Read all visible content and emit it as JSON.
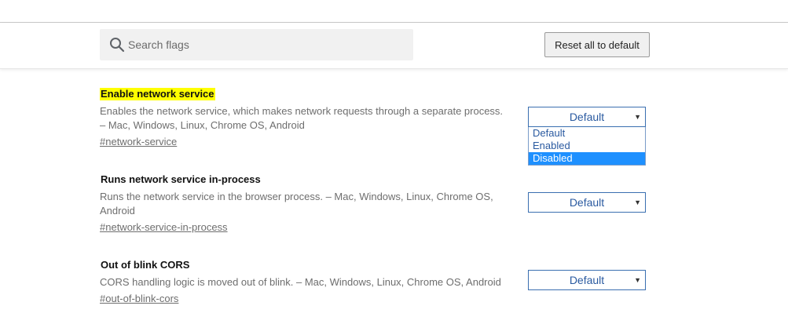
{
  "search": {
    "placeholder": "Search flags",
    "value": ""
  },
  "header": {
    "reset_label": "Reset all to default"
  },
  "flags": [
    {
      "title": "Enable network service",
      "description": "Enables the network service, which makes network requests through a separate process. – Mac, Windows, Linux, Chrome OS, Android",
      "link": "#network-service",
      "select_value": "Default",
      "highlighted": true
    },
    {
      "title": "Runs network service in-process",
      "description": "Runs the network service in the browser process. – Mac, Windows, Linux, Chrome OS, Android",
      "link": "#network-service-in-process",
      "select_value": "Default",
      "highlighted": false
    },
    {
      "title": "Out of blink CORS",
      "description": "CORS handling logic is moved out of blink. – Mac, Windows, Linux, Chrome OS, Android",
      "link": "#out-of-blink-cors",
      "select_value": "Default",
      "highlighted": false
    }
  ],
  "dropdown": {
    "options": [
      "Default",
      "Enabled",
      "Disabled"
    ],
    "highlighted_option": "Disabled"
  },
  "colors": {
    "highlight": "#ffff00",
    "select_border": "#3a6fb0",
    "select_text": "#2a5aa0",
    "option_selected_bg": "#1e90ff"
  },
  "icons": {
    "search": "search-icon",
    "dropdown": "chevron-down-icon"
  }
}
